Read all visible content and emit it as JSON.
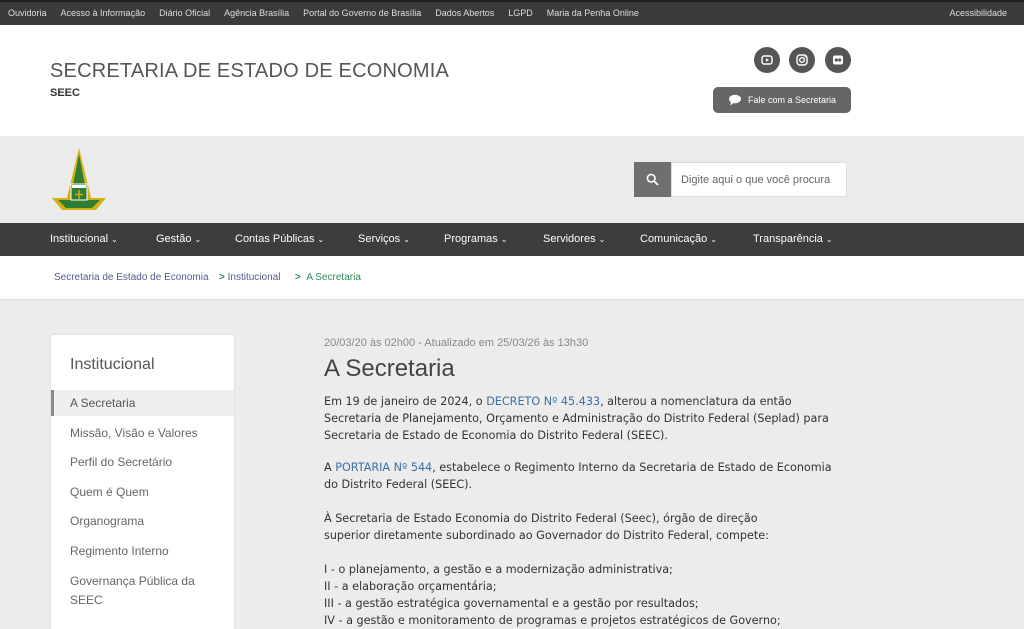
{
  "topbar": {
    "links": [
      "Ouvidoria",
      "Acesso à Informação",
      "Diário Oficial",
      "Agência Brasília",
      "Portal do Governo de Brasília",
      "Dados Abertos",
      "LGPD",
      "Maria da Penha Online"
    ],
    "accessibility": "Acessibilidade"
  },
  "header": {
    "title": "SECRETARIA DE ESTADO DE ECONOMIA",
    "subtitle": "SEEC",
    "contact_button": "Fale com a Secretaria",
    "social_icons": [
      "youtube-icon",
      "instagram-icon",
      "flickr-icon"
    ]
  },
  "search": {
    "placeholder": "Digite aqui o que você procura"
  },
  "nav": {
    "items": [
      "Institucional",
      "Gestão",
      "Contas Públicas",
      "Serviços",
      "Programas",
      "Servidores",
      "Comunicação",
      "Transparência"
    ]
  },
  "breadcrumb": {
    "home": "Secretaria de Estado de Economia",
    "section": "Institucional",
    "current": "A Secretaria",
    "separator": ">"
  },
  "sidebar": {
    "title": "Institucional",
    "items": [
      "A Secretaria",
      "Missão, Visão e Valores",
      "Perfil do Secretário",
      "Quem é Quem",
      "Organograma",
      "Regimento Interno",
      "Governança Pública da SEEC"
    ]
  },
  "article": {
    "meta": "20/03/20 às 02h00 - Atualizado em 25/03/26 às 13h30",
    "title": "A Secretaria",
    "p1_pre": "Em 19 de janeiro de 2024, o ",
    "p1_link": "DECRETO Nº 45.433",
    "p1_post": ", alterou a nomenclatura da então Secretaria de Planejamento, Orçamento e Administração do Distrito Federal (Seplad) para Secretaria de Estado de Economia do Distrito Federal (SEEC).",
    "p2_pre": "A ",
    "p2_link": "PORTARIA Nº 544",
    "p2_post": ", estabelece o Regimento Interno da Secretaria de Estado de Economia do Distrito Federal (SEEC).",
    "p3_line1": "À Secretaria de Estado Economia do Distrito Federal (Seec), órgão de direção",
    "p3_line2": "superior diretamente subordinado ao Governador do Distrito Federal, compete:",
    "list": [
      "I - o planejamento, a gestão e a modernização administrativa;",
      "II - a elaboração orçamentária;",
      "III - a gestão estratégica governamental e a gestão por resultados;",
      "IV - a gestão e monitoramento de programas e projetos estratégicos de Governo;"
    ]
  },
  "colors": {
    "topbar": "#3b3b3b",
    "nav": "#3d3d3d",
    "link": "#3b6fa6",
    "breadcrumb_current": "#2e8b57"
  }
}
